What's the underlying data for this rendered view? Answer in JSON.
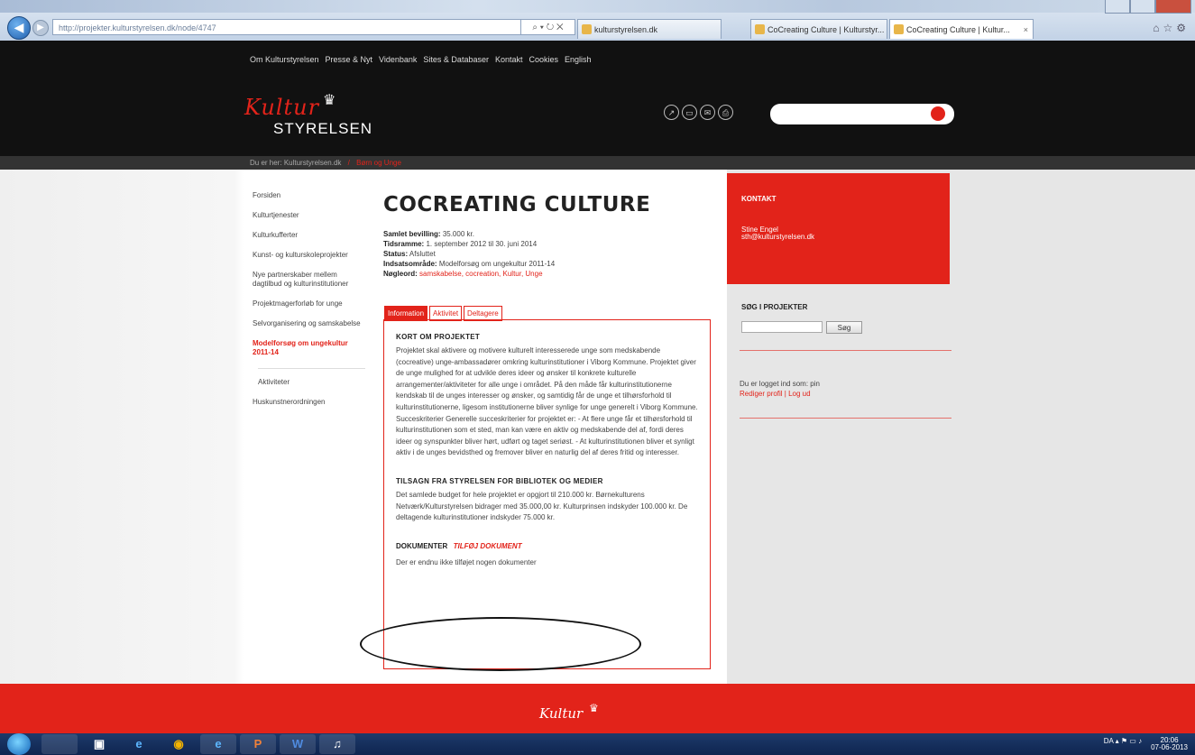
{
  "browser": {
    "address": "http://projekter.kulturstyrelsen.dk/node/4747",
    "addr_controls": "⌕ ▾ ↻ ✕",
    "tabs": [
      {
        "label": "kulturstyrelsen.dk"
      },
      {
        "label": "CoCreating Culture | Kulturstyr..."
      },
      {
        "label": "CoCreating Culture | Kultur..."
      }
    ]
  },
  "site": {
    "topnav": [
      "Om Kulturstyrelsen",
      "Presse & Nyt",
      "Videnbank",
      "Sites & Databaser",
      "Kontakt",
      "Cookies",
      "English"
    ],
    "logo_script": "Kultur",
    "logo_word": "STYRELSEN",
    "breadcrumb": {
      "prefix": "Du er her:",
      "home": "Kulturstyrelsen.dk",
      "current": "Børn og Unge"
    }
  },
  "leftnav": [
    {
      "label": "Forsiden"
    },
    {
      "label": "Kulturtjenester"
    },
    {
      "label": "Kulturkufferter"
    },
    {
      "label": "Kunst- og kulturskoleprojekter"
    },
    {
      "label": "Nye partnerskaber mellem dagtilbud og kulturinstitutioner"
    },
    {
      "label": "Projektmagerforløb for unge"
    },
    {
      "label": "Selvorganisering og samskabelse"
    },
    {
      "label": "Modelforsøg om ungekultur 2011-14"
    },
    {
      "label": "Aktiviteter"
    },
    {
      "label": "Huskunstnerordningen"
    }
  ],
  "content": {
    "title": "COCREATING CULTURE",
    "meta": {
      "bevilling_label": "Samlet bevilling:",
      "bevilling": "35.000 kr.",
      "tidsramme_label": "Tidsramme:",
      "tidsramme": "1. september 2012 til 30. juni 2014",
      "status_label": "Status:",
      "status": "Afsluttet",
      "indsats_label": "Indsatsområde:",
      "indsats": "Modelforsøg om ungekultur 2011-14",
      "noegleord_label": "Nøgleord:",
      "noegleord": "samskabelse, cocreation, Kultur, Unge"
    },
    "tabs": [
      "Information",
      "Aktivitet",
      "Deltagere"
    ],
    "sec1_title": "KORT OM PROJEKTET",
    "sec1_text": "Projektet skal aktivere og motivere kulturelt interesserede unge som medskabende (cocreative) unge-ambassadører omkring kulturinstitutioner i Viborg Kommune. Projektet giver de unge mulighed for at udvikle deres ideer og ønsker til konkrete kulturelle arrangementer/aktiviteter for alle unge i området. På den måde får kulturinstitutionerne kendskab til de unges interesser og ønsker, og samtidig får de unge et tilhørsforhold til kulturinstitutionerne, ligesom institutionerne bliver synlige for unge generelt i Viborg Kommune. Succeskriterier Generelle succeskriterier for projektet er: - At flere unge får et tilhørsforhold til kulturinstitutionen som et sted, man kan være en aktiv og medskabende del af, fordi deres ideer og synspunkter bliver hørt, udført og taget seriøst. - At kulturinstitutionen bliver et synligt aktiv i de unges bevidsthed og fremover bliver en naturlig del af deres fritid og interesser.",
    "sec2_title": "TILSAGN FRA STYRELSEN FOR BIBLIOTEK OG MEDIER",
    "sec2_text": "Det samlede budget for hele projektet er opgjort til 210.000 kr. Børnekulturens Netværk/Kulturstyrelsen bidrager med 35.000,00 kr. Kulturprinsen indskyder 100.000 kr. De deltagende kulturinstitutioner indskyder 75.000 kr.",
    "doc_title": "DOKUMENTER",
    "doc_add": "TILFØJ DOKUMENT",
    "doc_empty": "Der er endnu ikke tilføjet nogen dokumenter"
  },
  "sidebar": {
    "contact_title": "KONTAKT",
    "contact_name": "Stine Engel",
    "contact_email": "sth@kulturstyrelsen.dk",
    "search_title": "SØG I PROJEKTER",
    "search_button": "Søg",
    "login_text": "Du er logget ind som: pin",
    "login_links": "Rediger profil | Log ud"
  },
  "footer": {
    "logo": "Kultur"
  },
  "taskbar": {
    "apps": [
      "e",
      "◉",
      "e",
      "P",
      "W",
      "♫"
    ],
    "tray": "DA ▴ ⚑ ▭ ♪",
    "time": "20:06",
    "date": "07-06-2013"
  }
}
